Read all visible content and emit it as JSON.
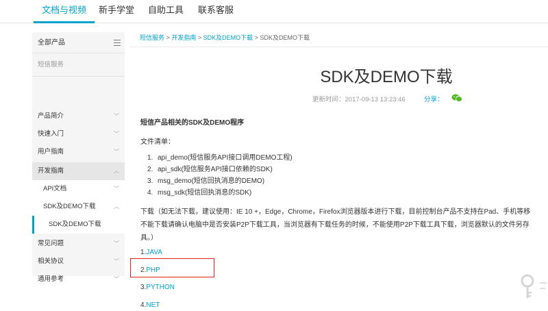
{
  "topnav": {
    "items": [
      {
        "label": "文档与视频"
      },
      {
        "label": "新手学堂"
      },
      {
        "label": "自助工具"
      },
      {
        "label": "联系客服"
      }
    ]
  },
  "sidebar": {
    "header": "全部产品",
    "service": "短信服务",
    "items": [
      {
        "label": "产品简介"
      },
      {
        "label": "快速入门"
      },
      {
        "label": "用户指南"
      },
      {
        "label": "开发指南"
      },
      {
        "label": "API文档"
      },
      {
        "label": "SDK及DEMO下载"
      },
      {
        "label": "SDK及DEMO下载"
      },
      {
        "label": "常见问题"
      },
      {
        "label": "相关协议"
      },
      {
        "label": "通用参考"
      }
    ]
  },
  "breadcrumb": {
    "items": [
      "短信服务",
      "开发指南",
      "SDK及DEMO下载",
      "SDK及DEMO下载"
    ],
    "separator": ">"
  },
  "article": {
    "title": "SDK及DEMO下载",
    "updated": "更新时间：2017-09-13 13:23:46",
    "share": "分享：",
    "intro": "短信产品相关的SDK及DEMO程序",
    "file_list_label": "文件清单：",
    "files": [
      {
        "num": "1.",
        "text": "api_demo(短信服务API接口调用DEMO工程)"
      },
      {
        "num": "2.",
        "text": "api_sdk(短信服务API接口依赖的SDK)"
      },
      {
        "num": "3.",
        "text": "msg_demo(短信回执消息的DEMO)"
      },
      {
        "num": "4.",
        "text": "msg_sdk(短信回执消息的SDK)"
      }
    ],
    "para_line1": "下载（如无法下载，建议使用：IE 10 +，Edge，Chrome，Firefox浏览器版本进行下载，目前控制台产品不支持在Pad、手机等移",
    "para_line2": "不能下载请确认电脑中是否安装P2P下载工具，当浏览器有下载任务的时候，不能使用P2P下载工具下载，浏览器默认的文件另存",
    "para_line3": "具。）",
    "links": [
      {
        "num": "1.",
        "label": "JAVA"
      },
      {
        "num": "2.",
        "label": "PHP"
      },
      {
        "num": "3.",
        "label": "PYTHON"
      },
      {
        "num": "4.",
        "label": "NET"
      }
    ]
  },
  "colors": {
    "accent": "#00a2ca",
    "highlight": "#e31d1d",
    "wechat": "#52b722"
  },
  "icons": {
    "menu": "menu-icon",
    "chevron_down": "chevron-down-icon",
    "chevron_up": "chevron-up-icon",
    "wechat": "wechat-icon",
    "watermark": "key-watermark-icon"
  }
}
